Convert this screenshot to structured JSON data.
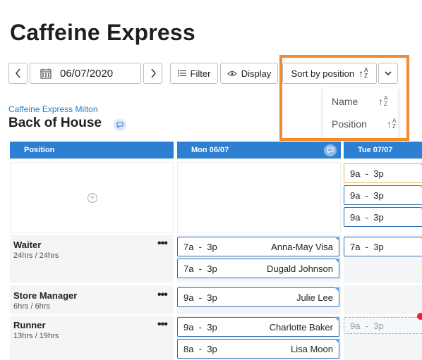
{
  "page": {
    "title": "Caffeine Express"
  },
  "toolbar": {
    "date": "06/07/2020",
    "filter_label": "Filter",
    "display_label": "Display",
    "sort_label": "Sort by position",
    "sort_options": [
      {
        "label": "Name"
      },
      {
        "label": "Position"
      }
    ]
  },
  "location": {
    "name": "Caffeine Express Milton",
    "area": "Back of House"
  },
  "columns": {
    "position": "Position",
    "mon": "Mon 06/07",
    "tue": "Tue 07/07"
  },
  "rows": [
    {
      "label": "Waiter",
      "hours": "24hrs / 24hrs"
    },
    {
      "label": "Store Manager",
      "hours": "6hrs / 6hrs"
    },
    {
      "label": "Runner",
      "hours": "13hrs / 19hrs"
    }
  ],
  "shifts": {
    "unassigned_tue": [
      "9a  -  3p",
      "9a  -  3p",
      "9a  -  3p"
    ],
    "waiter_mon": [
      {
        "time": "7a  -  3p",
        "name": "Anna-May Visa"
      },
      {
        "time": "7a  -  3p",
        "name": "Dugald Johnson"
      }
    ],
    "waiter_tue": "7a  -  3p",
    "manager_mon": {
      "time": "9a  -  3p",
      "name": "Julie Lee"
    },
    "runner_mon": [
      {
        "time": "9a  -  3p",
        "name": "Charlotte Baker"
      },
      {
        "time": "8a  -  3p",
        "name": "Lisa Moon"
      }
    ],
    "runner_tue": "9a  -  3p"
  },
  "colors": {
    "accent": "#2d7fd1",
    "highlight": "#f28a2e",
    "link": "#2f7dc1"
  }
}
